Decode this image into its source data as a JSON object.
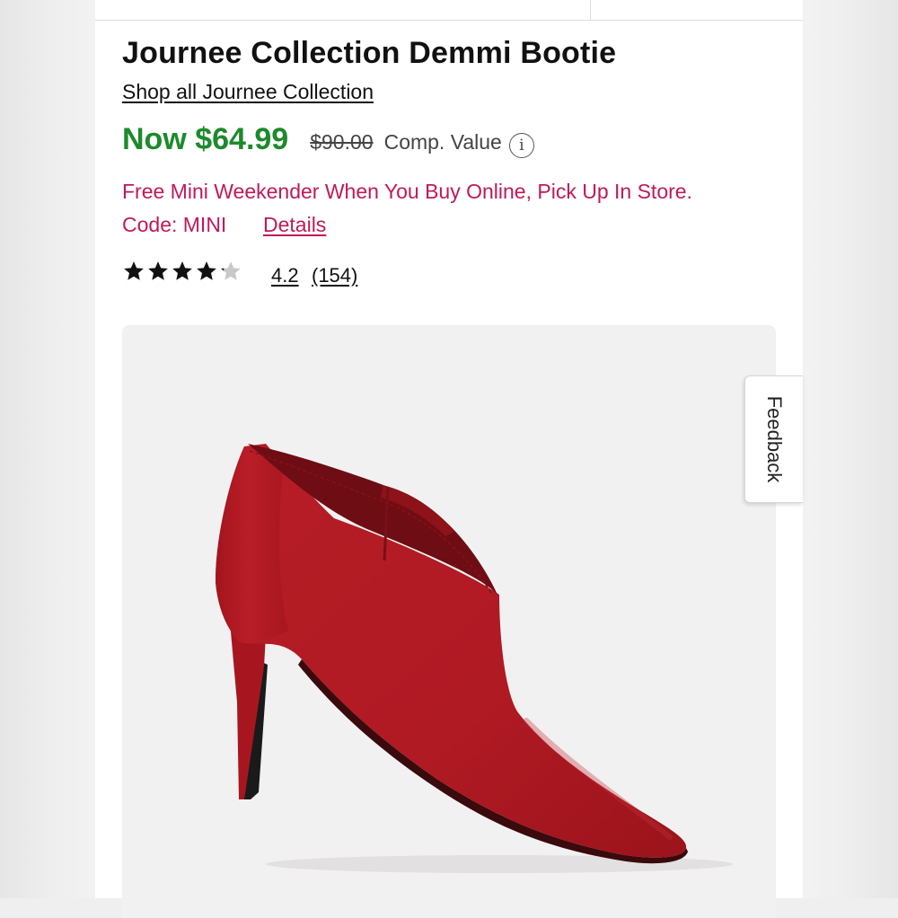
{
  "product": {
    "title": "Journee Collection Demmi Bootie",
    "brand_link": "Shop all Journee Collection"
  },
  "pricing": {
    "now_price": "Now $64.99",
    "original_price": "$90.00",
    "comp_label": "Comp. Value",
    "info_icon": "i"
  },
  "promo": {
    "line1": "Free Mini Weekender When You Buy Online, Pick Up In Store.",
    "code": "Code: MINI",
    "details_label": "Details"
  },
  "rating": {
    "value": "4.2",
    "count": "(154)",
    "stars_filled": 4.2,
    "stars_total": 5
  },
  "feedback": {
    "label": "Feedback"
  },
  "colors": {
    "price_green": "#1d8a2b",
    "promo_pink": "#c2185b",
    "boot_red": "#b51c25",
    "image_bg": "#f2f1f1"
  },
  "image": {
    "icon": "red-suede-pointed-toe-stiletto-bootie"
  }
}
